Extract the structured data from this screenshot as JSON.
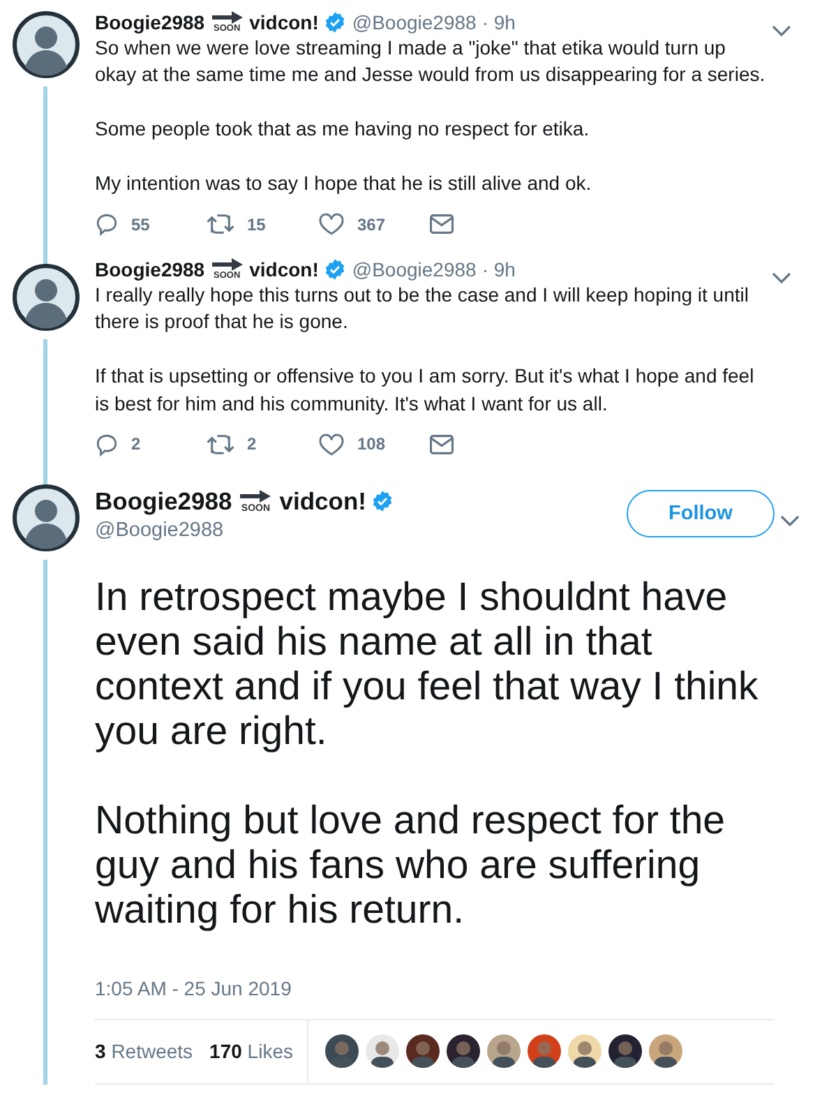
{
  "tweets": [
    {
      "kind": "compact",
      "name": {
        "first": "Boogie2988",
        "badge": "SOON",
        "last": "vidcon!"
      },
      "verified": true,
      "handle": "@Boogie2988",
      "time": "· 9h",
      "paragraphs": [
        "So when we were love streaming I made a \"joke\" that etika would turn up okay at the same time me and Jesse would from us disappearing for a series.",
        "Some people took that as me having no respect for etika.",
        "My intention was to say I hope that he is still alive and ok."
      ],
      "replies": "55",
      "retweets": "15",
      "likes": "367"
    },
    {
      "kind": "compact",
      "name": {
        "first": "Boogie2988",
        "badge": "SOON",
        "last": "vidcon!"
      },
      "verified": true,
      "handle": "@Boogie2988",
      "time": "· 9h",
      "paragraphs": [
        "I really really hope this turns out to be the case and I will keep hoping it until there is proof that he is gone.",
        "If that is upsetting or offensive to you I am sorry.  But it's what I hope and feel is best for him and his community.  It's what I want for us all."
      ],
      "replies": "2",
      "retweets": "2",
      "likes": "108"
    },
    {
      "kind": "focused",
      "name": {
        "first": "Boogie2988",
        "badge": "SOON",
        "last": "vidcon!"
      },
      "verified": true,
      "handle": "@Boogie2988",
      "follow_button": "Follow",
      "paragraphs": [
        "In retrospect maybe I shouldnt have even said his name at all in that context and if you feel that way I think you are right.",
        "Nothing but love and respect for the guy and his fans who are suffering waiting for his return."
      ],
      "timestamp": "1:05 AM - 25 Jun 2019",
      "retweet_count": "3",
      "retweet_label": "Retweets",
      "like_count": "170",
      "like_label": "Likes",
      "likers": [
        {
          "kind": "picture"
        },
        {
          "kind": "picture"
        },
        {
          "kind": "picture"
        },
        {
          "kind": "picture"
        },
        {
          "kind": "picture"
        },
        {
          "kind": "picture"
        },
        {
          "kind": "picture"
        },
        {
          "kind": "picture"
        },
        {
          "kind": "picture"
        }
      ]
    }
  ]
}
